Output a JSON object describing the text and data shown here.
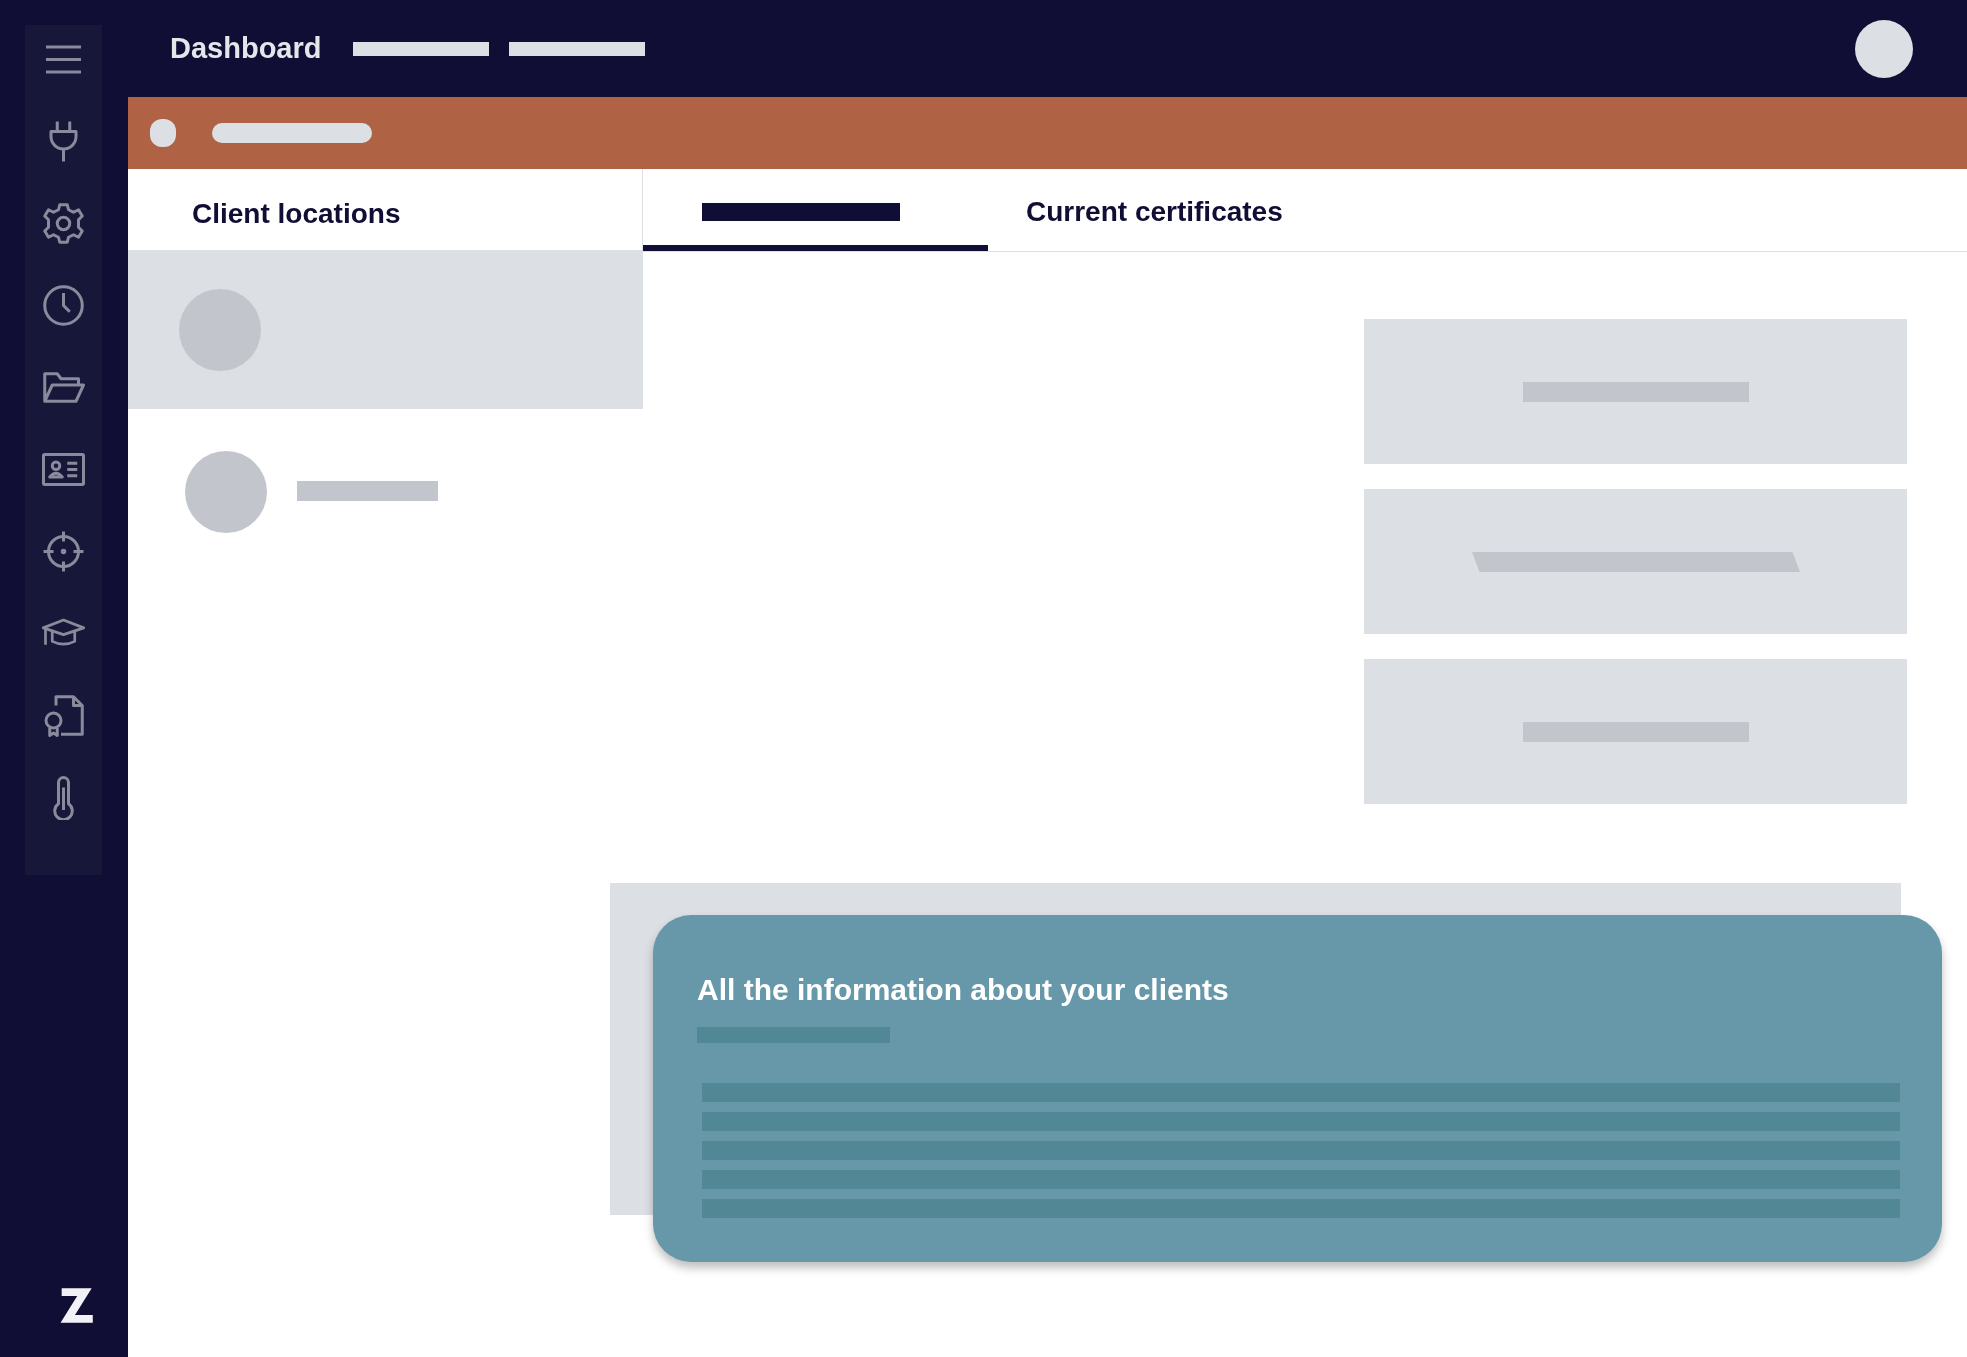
{
  "topbar": {
    "title": "Dashboard"
  },
  "panel": {
    "title": "Client locations"
  },
  "clients": [
    {
      "kind": "avatar",
      "selected": true
    },
    {
      "kind": "avatar-with-line",
      "selected": false
    }
  ],
  "tabs": [
    {
      "kind": "placeholder",
      "selected": true
    },
    {
      "kind": "text",
      "label": "Current certificates",
      "selected": false
    }
  ],
  "info_card": {
    "title": "All the information about your clients"
  }
}
